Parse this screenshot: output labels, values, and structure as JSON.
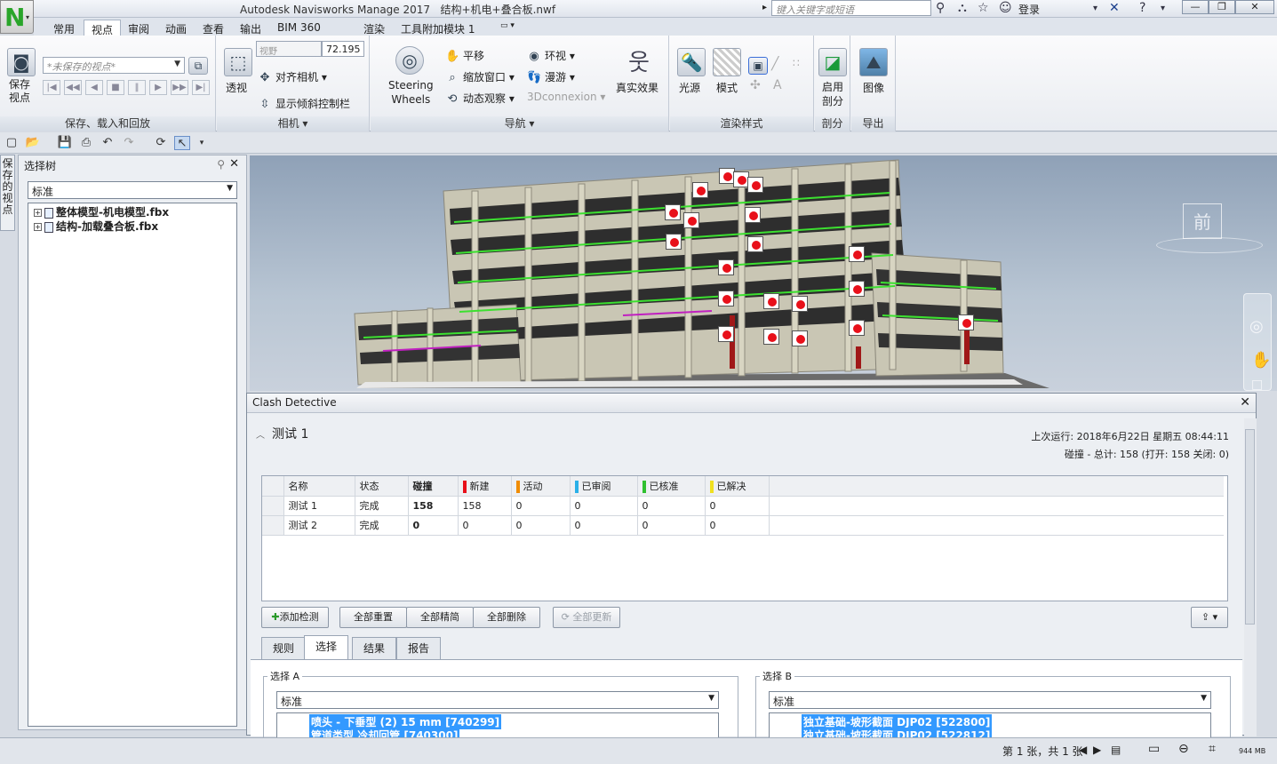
{
  "app": {
    "title": "Autodesk Navisworks Manage 2017",
    "document": "结构+机电+叠合板.nwf",
    "logo_letter": "N"
  },
  "titlebar": {
    "search_placeholder": "键入关键字或短语",
    "login_label": "登录",
    "icons": [
      "binoculars-icon",
      "exchange-icon",
      "star-icon",
      "user-icon",
      "x-icon",
      "help-icon"
    ]
  },
  "ribbon_tabs": [
    "常用",
    "视点",
    "审阅",
    "动画",
    "查看",
    "输出",
    "BIM 360",
    "渲染",
    "工具附加模块 1"
  ],
  "active_tab": "视点",
  "ribbon": {
    "save_panel": {
      "label": "保存、载入和回放",
      "save_button": "保存\n视点",
      "viewpoint_placeholder": "*未保存的视点*"
    },
    "camera_panel": {
      "label": "相机",
      "perspective": "透视",
      "fov_label": "视野",
      "fov_value": "72.195",
      "align_camera": "对齐相机",
      "show_tilt": "显示倾斜控制栏"
    },
    "nav_panel": {
      "label": "导航",
      "steering": "Steering\nWheels",
      "pan": "平移",
      "zoom_window": "缩放窗口",
      "orbit": "动态观察",
      "look_around": "环视",
      "walk": "漫游",
      "connexion": "3Dconnexion",
      "realism": "真实效果"
    },
    "render_panel": {
      "label": "渲染样式",
      "light": "光源",
      "mode": "模式"
    },
    "section_panel": {
      "label": "剖分",
      "enable": "启用\n剖分"
    },
    "export_panel": {
      "label": "导出",
      "image": "图像"
    }
  },
  "left_strip": {
    "label": "保存的视点"
  },
  "selection_tree": {
    "title": "选择树",
    "mode": "标准",
    "items": [
      "整体模型-机电模型.fbx",
      "结构-加载叠合板.fbx"
    ]
  },
  "viewport": {
    "viewcube_label": "前"
  },
  "clash": {
    "title": "Clash Detective",
    "test_name": "测试 1",
    "last_run": "上次运行: 2018年6月22日 星期五 08:44:11",
    "summary": "碰撞 - 总计: 158 (打开: 158  关闭: 0)",
    "columns": [
      "名称",
      "状态",
      "碰撞",
      "新建",
      "活动",
      "已审阅",
      "已核准",
      "已解决"
    ],
    "column_colors": [
      "",
      "",
      "",
      "#e8101a",
      "#f08c00",
      "#2ab0e8",
      "#30c030",
      "#f0e020"
    ],
    "rows": [
      [
        "测试 1",
        "完成",
        "158",
        "158",
        "0",
        "0",
        "0",
        "0"
      ],
      [
        "测试 2",
        "完成",
        "0",
        "0",
        "0",
        "0",
        "0",
        "0"
      ]
    ],
    "buttons": {
      "add_test": "添加检测",
      "reset_all": "全部重置",
      "compact_all": "全部精简",
      "delete_all": "全部删除",
      "update_all": "全部更新"
    },
    "tabs": [
      "规则",
      "选择",
      "结果",
      "报告"
    ],
    "active_tab": "选择",
    "selection_a": {
      "label": "选择 A",
      "mode": "标准",
      "item": "喷头 - 下垂型 (2) 15 mm [740299]",
      "item2": "管道类型 冷却回管 [740300]"
    },
    "selection_b": {
      "label": "选择 B",
      "mode": "标准",
      "item": "独立基础-坡形截面 DJP02 [522800]",
      "item2": "独立基础-坡形截面 DJP02 [522812]"
    }
  },
  "status": {
    "page": "第 1 张，共 1 张",
    "memory": "944 MB"
  }
}
